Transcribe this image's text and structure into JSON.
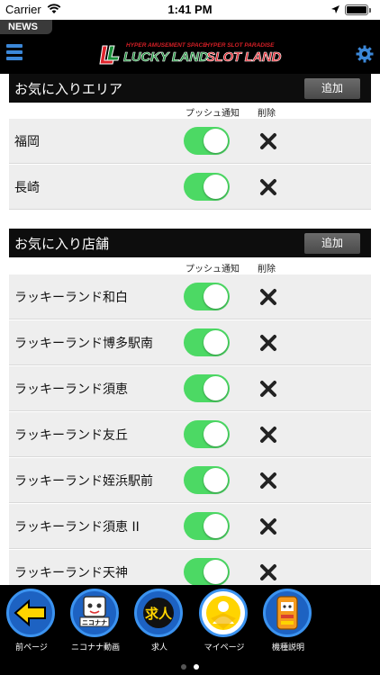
{
  "status_bar": {
    "carrier": "Carrier",
    "time": "1:41 PM"
  },
  "header": {
    "news_tab": "NEWS",
    "logo_small_left": "HYPER AMUSEMENT SPACE",
    "logo_small_right": "HYPER SLOT PARADISE",
    "logo_main_left": "LUCKY LAND",
    "logo_main_right": "SLOT LAND"
  },
  "favorite_areas": {
    "title": "お気に入りエリア",
    "add_label": "追加",
    "col_push": "プッシュ通知",
    "col_delete": "削除",
    "items": [
      {
        "name": "福岡",
        "push_enabled": true
      },
      {
        "name": "長崎",
        "push_enabled": true
      }
    ]
  },
  "favorite_stores": {
    "title": "お気に入り店舗",
    "add_label": "追加",
    "col_push": "プッシュ通知",
    "col_delete": "削除",
    "items": [
      {
        "name": "ラッキーランド和白",
        "push_enabled": true
      },
      {
        "name": "ラッキーランド博多駅南",
        "push_enabled": true
      },
      {
        "name": "ラッキーランド須恵",
        "push_enabled": true
      },
      {
        "name": "ラッキーランド友丘",
        "push_enabled": true
      },
      {
        "name": "ラッキーランド姪浜駅前",
        "push_enabled": true
      },
      {
        "name": "ラッキーランド須恵 II",
        "push_enabled": true
      },
      {
        "name": "ラッキーランド天神",
        "push_enabled": true
      }
    ]
  },
  "bottom_nav": {
    "items": [
      {
        "label": "前ページ",
        "icon": "back-arrow-icon"
      },
      {
        "label": "ニコナナ動画",
        "icon": "nikonana-mascot-icon",
        "badge": "ニコナナ"
      },
      {
        "label": "求人",
        "icon": "job-icon",
        "badge": "求人"
      },
      {
        "label": "マイページ",
        "icon": "user-icon"
      },
      {
        "label": "機種説明",
        "icon": "machine-icon"
      }
    ]
  },
  "pager": {
    "pages": 2,
    "current": 2
  },
  "colors": {
    "toggle_on": "#4cd964",
    "accent_blue": "#3b87d8",
    "header_bg": "#000000",
    "row_bg": "#eeeeee"
  }
}
